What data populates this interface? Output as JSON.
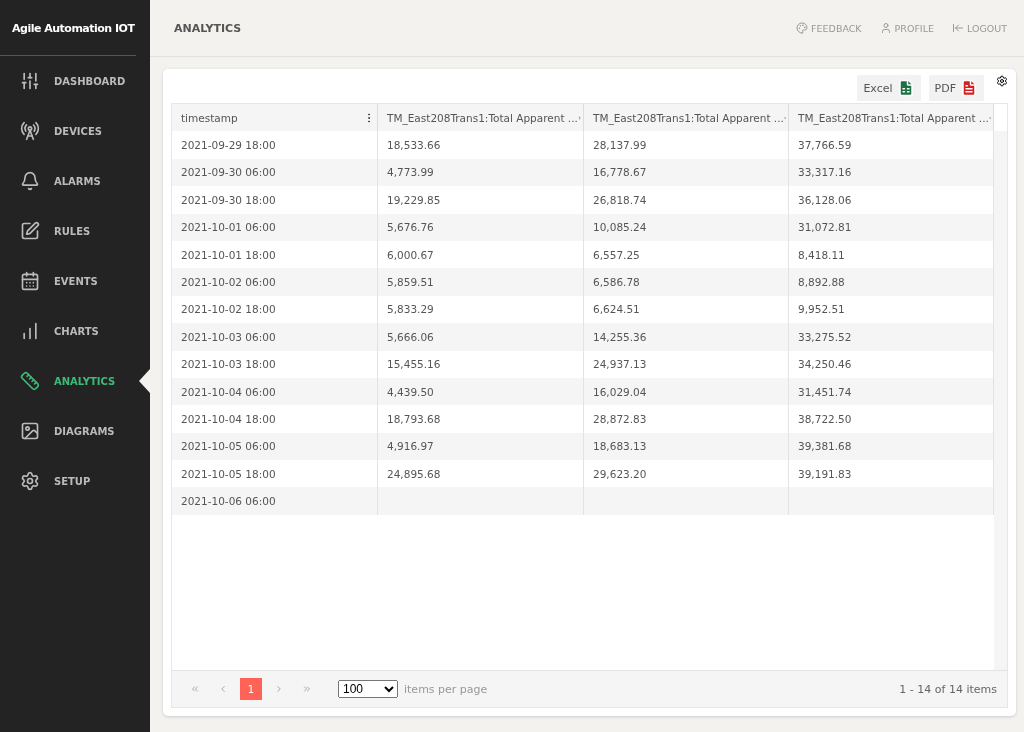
{
  "brand": "Agile Automation IOT",
  "sidebar": {
    "items": [
      {
        "label": "DASHBOARD",
        "selected": false
      },
      {
        "label": "DEVICES",
        "selected": false
      },
      {
        "label": "ALARMS",
        "selected": false
      },
      {
        "label": "RULES",
        "selected": false
      },
      {
        "label": "EVENTS",
        "selected": false
      },
      {
        "label": "CHARTS",
        "selected": false
      },
      {
        "label": "ANALYTICS",
        "selected": true
      },
      {
        "label": "DIAGRAMS",
        "selected": false
      },
      {
        "label": "SETUP",
        "selected": false
      }
    ]
  },
  "header": {
    "title": "ANALYTICS",
    "links": [
      {
        "label": "FEEDBACK"
      },
      {
        "label": "PROFILE"
      },
      {
        "label": "LOGOUT"
      }
    ]
  },
  "export_buttons": [
    {
      "label": "Excel",
      "kind": "excel"
    },
    {
      "label": "PDF",
      "kind": "pdf"
    }
  ],
  "table": {
    "columns": [
      "timestamp",
      "TM_East208Trans1:Total Apparent ...",
      "TM_East208Trans1:Total Apparent ...",
      "TM_East208Trans1:Total Apparent ..."
    ],
    "rows": [
      [
        "2021-09-29 18:00",
        "18,533.66",
        "28,137.99",
        "37,766.59"
      ],
      [
        "2021-09-30 06:00",
        "4,773.99",
        "16,778.67",
        "33,317.16"
      ],
      [
        "2021-09-30 18:00",
        "19,229.85",
        "26,818.74",
        "36,128.06"
      ],
      [
        "2021-10-01 06:00",
        "5,676.76",
        "10,085.24",
        "31,072.81"
      ],
      [
        "2021-10-01 18:00",
        "6,000.67",
        "6,557.25",
        "8,418.11"
      ],
      [
        "2021-10-02 06:00",
        "5,859.51",
        "6,586.78",
        "8,892.88"
      ],
      [
        "2021-10-02 18:00",
        "5,833.29",
        "6,624.51",
        "9,952.51"
      ],
      [
        "2021-10-03 06:00",
        "5,666.06",
        "14,255.36",
        "33,275.52"
      ],
      [
        "2021-10-03 18:00",
        "15,455.16",
        "24,937.13",
        "34,250.46"
      ],
      [
        "2021-10-04 06:00",
        "4,439.50",
        "16,029.04",
        "31,451.74"
      ],
      [
        "2021-10-04 18:00",
        "18,793.68",
        "28,872.83",
        "38,722.50"
      ],
      [
        "2021-10-05 06:00",
        "4,916.97",
        "18,683.13",
        "39,381.68"
      ],
      [
        "2021-10-05 18:00",
        "24,895.68",
        "29,623.20",
        "39,191.83"
      ],
      [
        "2021-10-06 06:00"
      ]
    ]
  },
  "pager": {
    "pages": [
      {
        "label": "1",
        "selected": true
      }
    ],
    "page_size": "100",
    "page_size_label": "items per page",
    "summary": "1 - 14 of 14 items"
  }
}
